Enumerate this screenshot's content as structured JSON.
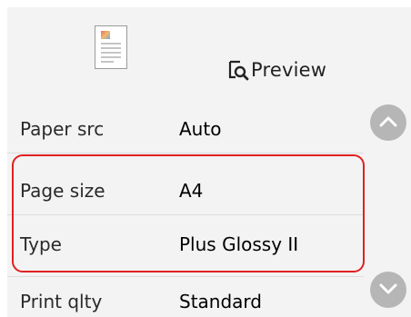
{
  "preview": {
    "label": "Preview",
    "icon": "preview-magnifier-icon"
  },
  "thumbnail": {
    "icon": "page-thumbnail-icon"
  },
  "settings": [
    {
      "label": "Paper src",
      "value": "Auto"
    },
    {
      "label": "Page size",
      "value": "A4"
    },
    {
      "label": "Type",
      "value": "Plus Glossy II"
    },
    {
      "label": "Print qlty",
      "value": "Standard"
    }
  ],
  "scroll": {
    "up_icon": "chevron-up-icon",
    "down_icon": "chevron-down-icon"
  },
  "colors": {
    "panel_bg": "#f3f3f3",
    "highlight": "#e02020",
    "scroll_button": "#b6b6b6"
  }
}
